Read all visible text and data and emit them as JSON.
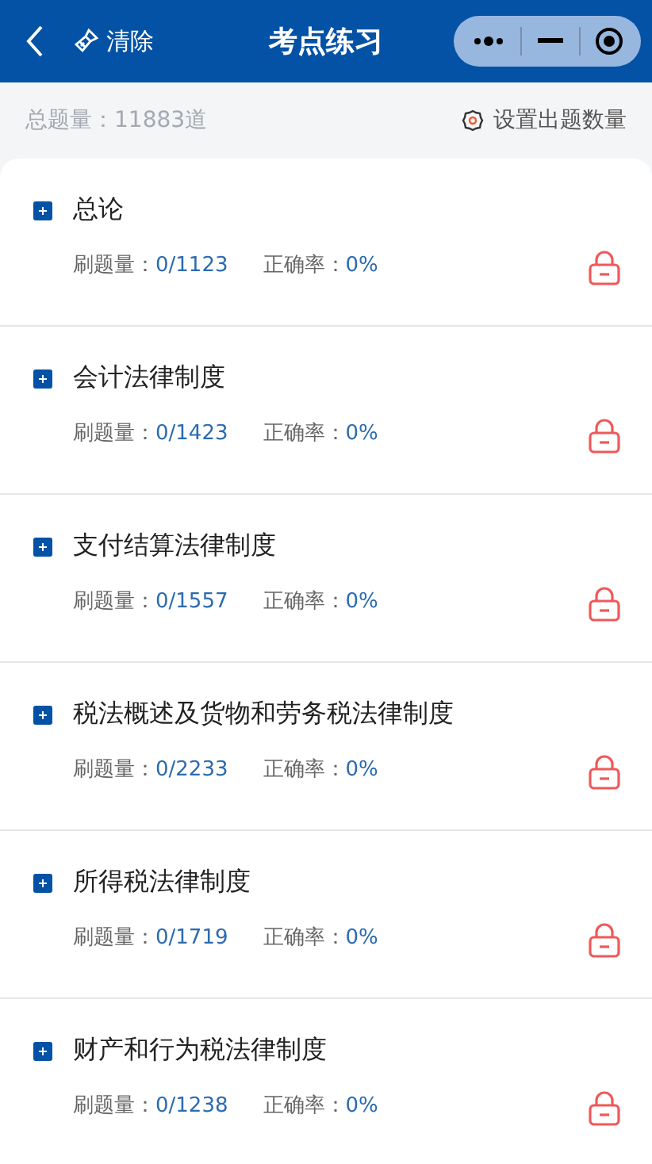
{
  "header": {
    "back_label": "清除",
    "title": "考点练习"
  },
  "summary": {
    "total": "总题量：11883道",
    "settings": "设置出题数量"
  },
  "chapters": [
    {
      "title": "总论",
      "count_label": "刷题量：",
      "count": "0/1123",
      "rate_label": "正确率：",
      "rate": "0%",
      "locked": true
    },
    {
      "title": "会计法律制度",
      "count_label": "刷题量：",
      "count": "0/1423",
      "rate_label": "正确率：",
      "rate": "0%",
      "locked": true
    },
    {
      "title": "支付结算法律制度",
      "count_label": "刷题量：",
      "count": "0/1557",
      "rate_label": "正确率：",
      "rate": "0%",
      "locked": true
    },
    {
      "title": "税法概述及货物和劳务税法律制度",
      "count_label": "刷题量：",
      "count": "0/2233",
      "rate_label": "正确率：",
      "rate": "0%",
      "locked": true
    },
    {
      "title": "所得税法律制度",
      "count_label": "刷题量：",
      "count": "0/1719",
      "rate_label": "正确率：",
      "rate": "0%",
      "locked": true
    },
    {
      "title": "财产和行为税法律制度",
      "count_label": "刷题量：",
      "count": "0/1238",
      "rate_label": "正确率：",
      "rate": "0%",
      "locked": true
    }
  ]
}
